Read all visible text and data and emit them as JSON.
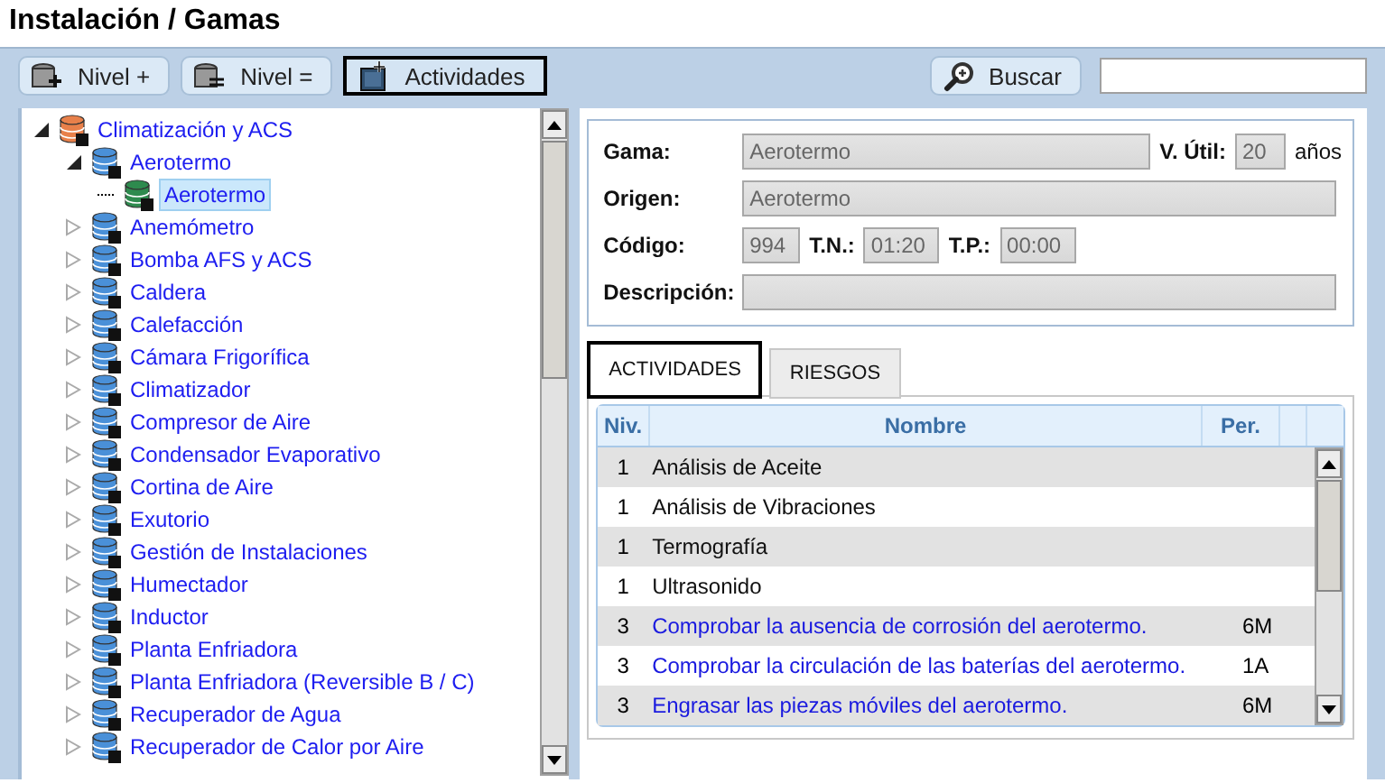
{
  "title": "Instalación / Gamas",
  "toolbar": {
    "buttons": [
      {
        "label": "Nivel +",
        "kind": "level-add",
        "highlighted": false
      },
      {
        "label": "Nivel =",
        "kind": "level-same",
        "highlighted": false
      },
      {
        "label": "Actividades",
        "kind": "activities",
        "highlighted": true
      }
    ],
    "search": {
      "label": "Buscar"
    }
  },
  "tree": [
    {
      "label": "Climatización y ACS",
      "expanded": true,
      "selected": false,
      "children": [
        {
          "label": "Aerotermo",
          "expanded": true,
          "selected": false,
          "children": [
            {
              "label": "Aerotermo",
              "selected": true
            }
          ]
        },
        {
          "label": "Anemómetro",
          "expanded": false,
          "selected": false
        },
        {
          "label": "Bomba AFS y ACS",
          "expanded": false,
          "selected": false
        },
        {
          "label": "Caldera",
          "expanded": false,
          "selected": false
        },
        {
          "label": "Calefacción",
          "expanded": false,
          "selected": false
        },
        {
          "label": "Cámara Frigorífica",
          "expanded": false,
          "selected": false
        },
        {
          "label": "Climatizador",
          "expanded": false,
          "selected": false
        },
        {
          "label": "Compresor de Aire",
          "expanded": false,
          "selected": false
        },
        {
          "label": "Condensador Evaporativo",
          "expanded": false,
          "selected": false
        },
        {
          "label": "Cortina de Aire",
          "expanded": false,
          "selected": false
        },
        {
          "label": "Exutorio",
          "expanded": false,
          "selected": false
        },
        {
          "label": "Gestión de Instalaciones",
          "expanded": false,
          "selected": false
        },
        {
          "label": "Humectador",
          "expanded": false,
          "selected": false
        },
        {
          "label": "Inductor",
          "expanded": false,
          "selected": false
        },
        {
          "label": "Planta Enfriadora",
          "expanded": false,
          "selected": false
        },
        {
          "label": "Planta Enfriadora (Reversible B / C)",
          "expanded": false,
          "selected": false
        },
        {
          "label": "Recuperador de Agua",
          "expanded": false,
          "selected": false
        },
        {
          "label": "Recuperador de Calor por Aire",
          "expanded": false,
          "selected": false
        }
      ]
    }
  ],
  "form": {
    "gama": {
      "label": "Gama:",
      "value": "Aerotermo"
    },
    "vida_util": {
      "label": "V. Útil:",
      "value": "20",
      "unit": "años"
    },
    "origen": {
      "label": "Origen:",
      "value": "Aerotermo"
    },
    "codigo": {
      "label": "Código:",
      "value": "994"
    },
    "tn": {
      "label": "T.N.:",
      "value": "01:20"
    },
    "tp": {
      "label": "T.P.:",
      "value": "00:00"
    },
    "descripcion": {
      "label": "Descripción:"
    }
  },
  "tabs": [
    {
      "label": "ACTIVIDADES",
      "selected": true
    },
    {
      "label": "RIESGOS",
      "selected": false
    }
  ],
  "table": {
    "columns": [
      "Niv.",
      "Nombre",
      "Per."
    ],
    "rows": [
      {
        "level": "1",
        "name": "Análisis de Aceite",
        "kind": "group"
      },
      {
        "level": "1",
        "name": "Análisis de Vibraciones",
        "kind": "group"
      },
      {
        "level": "1",
        "name": "Termografía",
        "kind": "group"
      },
      {
        "level": "1",
        "name": "Ultrasonido",
        "kind": "group"
      },
      {
        "level": "3",
        "name": "Comprobar la ausencia de corrosión del aerotermo.",
        "period": "6M",
        "kind": "task"
      },
      {
        "level": "3",
        "name": "Comprobar la circulación de las baterías del aerotermo.",
        "period": "1A",
        "kind": "task"
      },
      {
        "level": "3",
        "name": "Engrasar las piezas móviles del aerotermo.",
        "period": "6M",
        "kind": "task"
      }
    ]
  }
}
